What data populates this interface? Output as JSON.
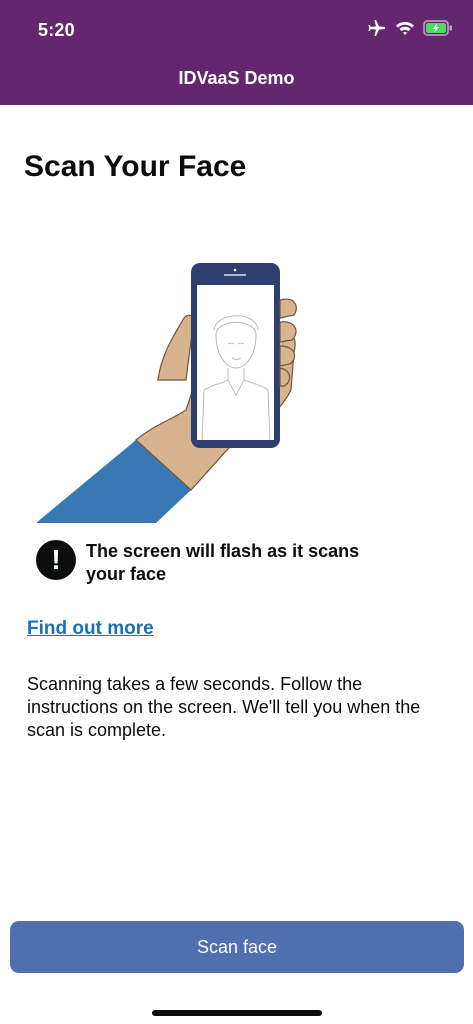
{
  "status_bar": {
    "time": "5:20",
    "icons": [
      "airplane-icon",
      "wifi-icon",
      "battery-charging-icon"
    ]
  },
  "header": {
    "title": "IDVaaS Demo",
    "background": "#64276f"
  },
  "main": {
    "title": "Scan Your Face",
    "illustration": "hand-holding-phone-face-illustration",
    "warning": {
      "icon": "exclamation-icon",
      "text": "The screen will flash as it scans your face"
    },
    "link": "Find out more",
    "description": "Scanning takes a few seconds. Follow the instructions on the screen. We'll tell you when the scan is complete."
  },
  "footer": {
    "button_label": "Scan face",
    "button_color": "#4f6fb0"
  }
}
